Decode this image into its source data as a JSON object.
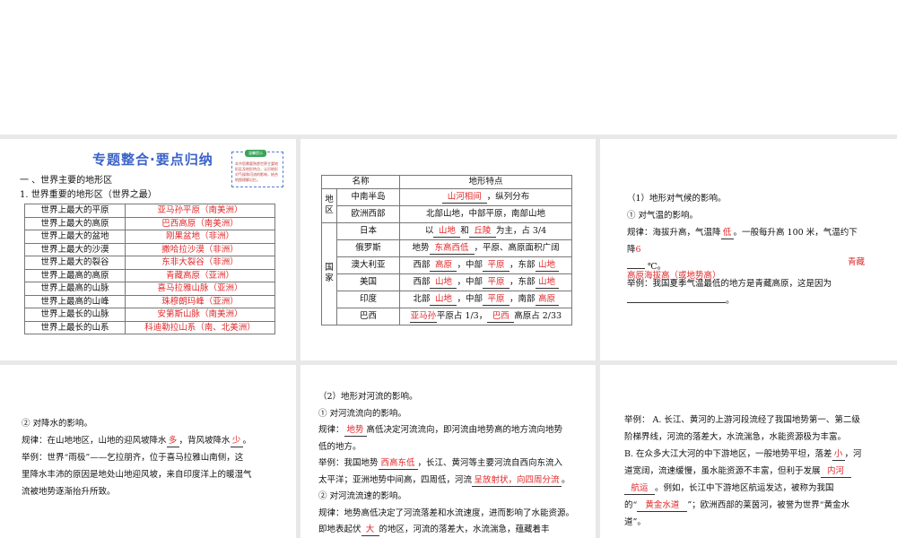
{
  "slide1": {
    "title": "专题整合·要点归纳",
    "badge_label": "温馨提示",
    "badge_text": "本节您需要熟悉世界主要地形区及地形特点，认识地形对气候和河流的影响，结合地图理解记忆。",
    "heading": "一 、世界主要的地形区",
    "subheading": "1. 世界重要的地形区（世界之最）",
    "rows": [
      [
        "世界上最大的平原",
        "亚马孙平原（南美洲）"
      ],
      [
        "世界上最大的高原",
        "巴西高原（南美洲）"
      ],
      [
        "世界上最大的盆地",
        "刚果盆地（非洲）"
      ],
      [
        "世界上最大的沙漠",
        "撒哈拉沙漠（非洲）"
      ],
      [
        "世界上最大的裂谷",
        "东非大裂谷（非洲）"
      ],
      [
        "世界上最高的高原",
        "青藏高原（亚洲）"
      ],
      [
        "世界上最高的山脉",
        "喜马拉雅山脉（亚洲）"
      ],
      [
        "世界上最高的山峰",
        "珠穆朗玛峰（亚洲）"
      ],
      [
        "世界上最长的山脉",
        "安第斯山脉（南美洲）"
      ],
      [
        "世界上最长的山系",
        "科迪勒拉山系（南、北美洲）"
      ]
    ]
  },
  "slide2": {
    "h_name": "名称",
    "h_feat": "地形特点",
    "g_region": "地区",
    "g_country": "国家",
    "r": [
      {
        "n": "中南半岛",
        "a": "山河相间",
        "t": "，纵列分布"
      },
      {
        "n": "欧洲西部",
        "t": "北部山地，中部平原，南部山地"
      },
      {
        "n": "日本",
        "p": "以",
        "a": "山地",
        "m": "和",
        "b": "丘陵",
        "t": "为主，占 3/4"
      },
      {
        "n": "俄罗斯",
        "p": "地势",
        "a": "东高西低",
        "t": "，平原、高原面积广阔"
      },
      {
        "n": "澳大利亚",
        "p": "西部",
        "a": "高原",
        "m": "，中部",
        "b": "平原",
        "q": "，东部",
        "c": "山地"
      },
      {
        "n": "美国",
        "p": "西部",
        "a": "山地",
        "m": "，中部",
        "b": "平原",
        "q": "，东部",
        "c": "山地"
      },
      {
        "n": "印度",
        "p": "北部",
        "a": "山地",
        "m": "，中部",
        "b": "平原",
        "q": "，南部",
        "c": "高原"
      },
      {
        "n": "巴西",
        "a": "亚马孙",
        "m": "平原占 1/3，",
        "b": "巴西",
        "t": "高原占 2/33"
      }
    ]
  },
  "slide3": {
    "l1": "（1）地形对气候的影响。",
    "l2": "① 对气温的影响。",
    "l3a": "规律：海拔升高，气温降",
    "a1": "低",
    "l3b": "。一般每升高 100 米，气温约下",
    "l4": "降",
    "a2": "6",
    "l5": "℃。",
    "a3": "青藏",
    "a4": "高原海拔高（或地势高）",
    "l6": "举例：我国夏季气温最低的地方是青藏高原，这是因为"
  },
  "slide4": {
    "l1": "② 对降水的影响。",
    "l2a": "规律：在山地地区，山地的迎风坡降水",
    "a1": "多",
    "l2b": "，背风坡降水",
    "a2": "少",
    "l2c": "。",
    "l3": "举例：世界“雨极”——乞拉朋齐，位于喜马拉雅山南侧，这",
    "l4": "里降水丰沛的原因是地处山地迎风坡，来自印度洋上的暖湿气",
    "l5": "流被地势逐渐抬升所致。"
  },
  "slide5": {
    "l1": "（2）地形对河流的影响。",
    "l2": "① 对河流流向的影响。",
    "l3a": "规律：",
    "a1": "地势",
    "l3b": "高低决定河流流向，即河流由地势高的地方流向地势",
    "l4": "低的地方。",
    "l5a": "举例：我国地势",
    "a2": "西高东低",
    "l5b": "，长江、黄河等主要河流自西向东流入",
    "l6a": "太平洋；亚洲地势中间高，四周低，河流",
    "a3": "呈放射状，向四周分流",
    "l6b": "。",
    "l7": "② 对河流流速的影响。",
    "l8": "规律：地势高低决定了河流落差和水流速度，进而影响了水能资源。",
    "l9a": "即地表起伏",
    "a4": "大",
    "l9b": "的地区，河流的落差大，水流湍急，蕴藏着丰"
  },
  "slide6": {
    "l1": "举例： A. 长江、黄河的上游河段流经了我国地势第一、第二级",
    "l2": "阶梯界线，河流的落差大，水流湍急，水能资源极为丰富。",
    "l3a": "B. 在众多大江大河的中下游地区，一般地势平坦，落差",
    "a1": "小",
    "l3b": "，河",
    "l4a": "道宽阔，流速缓慢，虽水能资源不丰富，但利于发展",
    "a2": "内河",
    "a3": "航运",
    "l5b": "。例如，长江中下游地区航运发达，被称为我国",
    "l6a": "的“",
    "a4": "黄金水道",
    "l6b": "”；欧洲西部的莱茵河，被誉为世界“黄金水",
    "l7": "道”。"
  }
}
